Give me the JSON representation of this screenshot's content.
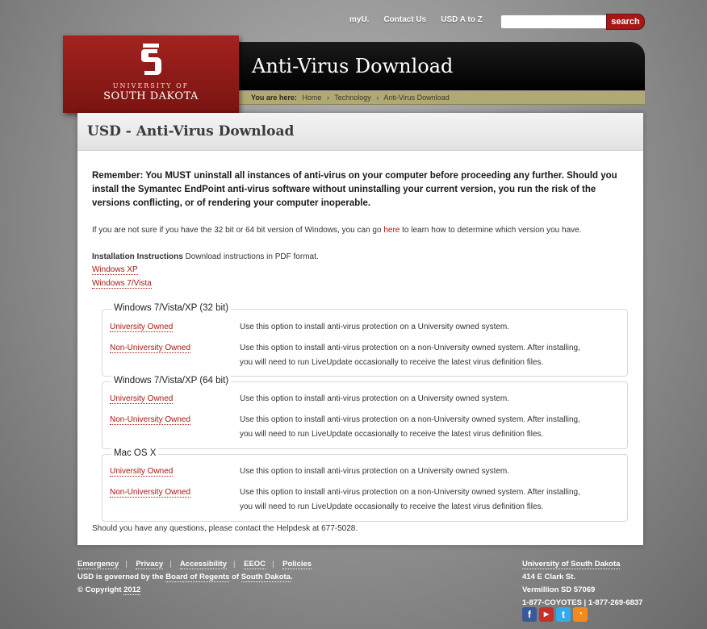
{
  "top_nav": {
    "links": [
      "myU.",
      "Contact Us",
      "USD A to Z"
    ],
    "search_placeholder": "",
    "search_button": "search"
  },
  "logo": {
    "line1": "UNIVERSITY OF",
    "line2": "SOUTH DAKOTA"
  },
  "header": {
    "title": "Anti-Virus Download",
    "breadcrumb_label": "You are here:",
    "breadcrumb": [
      "Home",
      "Technology",
      "Anti-Virus Download"
    ]
  },
  "main": {
    "page_title": "USD - Anti-Virus Download",
    "warning": "Remember: You MUST uninstall all instances of anti-virus on your computer before proceeding any further. Should you install the Symantec EndPoint anti-virus software without uninstalling your current version, you run the risk of the versions conflicting, or of rendering your computer inoperable.",
    "version_note_before": "If you are not sure if you have the 32 bit or 64 bit version of Windows, you can go",
    "version_note_link": "here",
    "version_note_after": "to learn how to determine which version you have.",
    "install_label": "Installation Instructions",
    "install_text": "Download instructions in PDF format.",
    "install_links": [
      "Windows XP",
      "Windows 7/Vista"
    ],
    "sections": [
      {
        "legend": "Windows 7/Vista/XP (32 bit)",
        "univ_label": "University Owned",
        "univ_desc": "Use this option to install anti-virus protection on a University owned system.",
        "nonuniv_label": "Non-University Owned",
        "nonuniv_desc1": "Use this option to install anti-virus protection on a non-University owned system. After installing,",
        "nonuniv_desc2": "you will need to run LiveUpdate occasionally to receive the latest virus definition files."
      },
      {
        "legend": "Windows 7/Vista/XP (64 bit)",
        "univ_label": "University Owned",
        "univ_desc": "Use this option to install anti-virus protection on a University owned system.",
        "nonuniv_label": "Non-University Owned",
        "nonuniv_desc1": "Use this option to install anti-virus protection on a non-University owned system. After installing,",
        "nonuniv_desc2": "you will need to run LiveUpdate occasionally to receive the latest virus definition files."
      },
      {
        "legend": "Mac OS X",
        "univ_label": "University Owned",
        "univ_desc": "Use this option to install anti-virus protection on a University owned system.",
        "nonuniv_label": "Non-University Owned",
        "nonuniv_desc1": "Use this option to install anti-virus protection on a non-University owned system. After installing,",
        "nonuniv_desc2": "you will need to run LiveUpdate occasionally to receive the latest virus definition files."
      }
    ],
    "helpdesk": "Should you have any questions, please contact the Helpdesk at 677-5028."
  },
  "footer": {
    "links": [
      "Emergency",
      "Privacy",
      "Accessibility",
      "EEOC",
      "Policies"
    ],
    "governed_before": "USD is governed by the",
    "governed_link1": "Board of Regents",
    "governed_mid": "of",
    "governed_link2": "South Dakota",
    "governed_after": ".",
    "copyright_before": "© Copyright",
    "copyright_year": "2012",
    "address": [
      "University of South Dakota",
      "414 E Clark St.",
      "Vermillion SD 57069",
      "1-877-COYOTES | 1-877-269-6837"
    ],
    "social_icons": [
      "facebook-icon",
      "youtube-icon",
      "twitter-icon",
      "rss-icon"
    ]
  },
  "colors": {
    "brand_red": "#a61815",
    "breadcrumb_bar": "#b1a975",
    "header_black": "#000000"
  }
}
